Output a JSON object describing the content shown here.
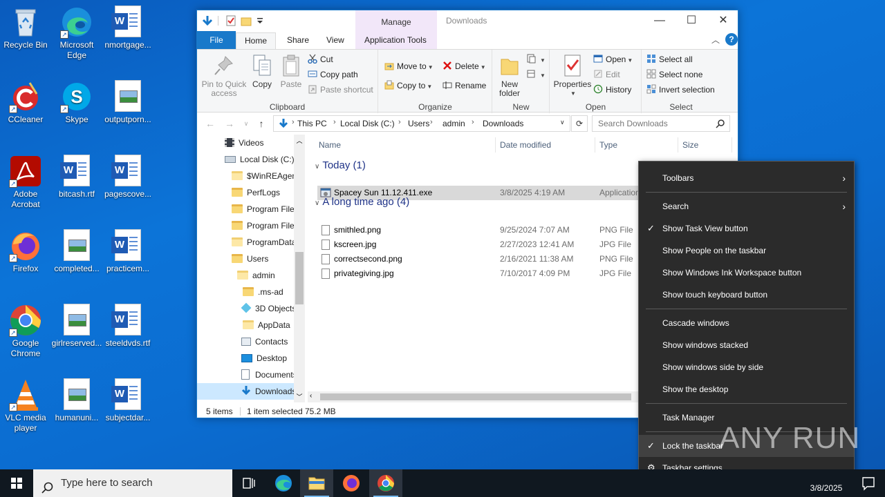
{
  "desktop": {
    "icons": [
      {
        "label": "Recycle Bin",
        "kind": "recycle-bin"
      },
      {
        "label": "Microsoft Edge",
        "kind": "edge"
      },
      {
        "label": "nmortgage...",
        "kind": "word"
      },
      {
        "label": "CCleaner",
        "kind": "ccleaner"
      },
      {
        "label": "Skype",
        "kind": "skype"
      },
      {
        "label": "outputporn...",
        "kind": "image"
      },
      {
        "label": "Adobe Acrobat",
        "kind": "acrobat"
      },
      {
        "label": "bitcash.rtf",
        "kind": "word"
      },
      {
        "label": "pagescove...",
        "kind": "word"
      },
      {
        "label": "Firefox",
        "kind": "firefox"
      },
      {
        "label": "completed...",
        "kind": "image"
      },
      {
        "label": "practicem...",
        "kind": "word"
      },
      {
        "label": "Google Chrome",
        "kind": "chrome"
      },
      {
        "label": "girlreserved...",
        "kind": "image"
      },
      {
        "label": "steeldvds.rtf",
        "kind": "word"
      },
      {
        "label": "VLC media player",
        "kind": "vlc"
      },
      {
        "label": "humanuni...",
        "kind": "image"
      },
      {
        "label": "subjectdar...",
        "kind": "word"
      }
    ]
  },
  "explorer": {
    "title": "Downloads",
    "manage_label": "Manage",
    "tabs": {
      "file": "File",
      "home": "Home",
      "share": "Share",
      "view": "View",
      "app_tools": "Application Tools"
    },
    "ribbon": {
      "clipboard": {
        "label": "Clipboard",
        "pin": "Pin to Quick access",
        "copy": "Copy",
        "paste": "Paste",
        "cut": "Cut",
        "copy_path": "Copy path",
        "paste_shortcut": "Paste shortcut"
      },
      "organize": {
        "label": "Organize",
        "move_to": "Move to",
        "copy_to": "Copy to",
        "delete": "Delete",
        "rename": "Rename"
      },
      "new": {
        "label": "New",
        "new_folder": "New folder"
      },
      "open": {
        "label": "Open",
        "properties": "Properties",
        "open": "Open",
        "edit": "Edit",
        "history": "History"
      },
      "select": {
        "label": "Select",
        "select_all": "Select all",
        "select_none": "Select none",
        "invert": "Invert selection"
      }
    },
    "address": {
      "crumbs": [
        "This PC",
        "Local Disk (C:)",
        "Users",
        "admin",
        "Downloads"
      ],
      "search_placeholder": "Search Downloads"
    },
    "nav_pane": [
      {
        "label": "Videos",
        "kind": "videos"
      },
      {
        "label": "Local Disk (C:)",
        "kind": "drive"
      },
      {
        "label": "$WinREAgent",
        "kind": "folder-pale"
      },
      {
        "label": "PerfLogs",
        "kind": "folder"
      },
      {
        "label": "Program Files",
        "kind": "folder"
      },
      {
        "label": "Program Files",
        "kind": "folder"
      },
      {
        "label": "ProgramData",
        "kind": "folder-pale"
      },
      {
        "label": "Users",
        "kind": "folder"
      },
      {
        "label": "admin",
        "kind": "folder-pale"
      },
      {
        "label": ".ms-ad",
        "kind": "folder"
      },
      {
        "label": "3D Objects",
        "kind": "3d"
      },
      {
        "label": "AppData",
        "kind": "folder-pale"
      },
      {
        "label": "Contacts",
        "kind": "contacts"
      },
      {
        "label": "Desktop",
        "kind": "desktop"
      },
      {
        "label": "Documents",
        "kind": "documents"
      },
      {
        "label": "Downloads",
        "kind": "downloads"
      }
    ],
    "columns": {
      "name": "Name",
      "date": "Date modified",
      "type": "Type",
      "size": "Size"
    },
    "groups": [
      {
        "title": "Today (1)",
        "files": [
          {
            "name": "Spacey Sun 11.12.411.exe",
            "date": "3/8/2025 4:19 AM",
            "type": "Application",
            "selected": true
          }
        ]
      },
      {
        "title": "A long time ago (4)",
        "files": [
          {
            "name": "smithled.png",
            "date": "9/25/2024 7:07 AM",
            "type": "PNG File"
          },
          {
            "name": "kscreen.jpg",
            "date": "2/27/2023 12:41 AM",
            "type": "JPG File"
          },
          {
            "name": "correctsecond.png",
            "date": "2/16/2021 11:38 AM",
            "type": "PNG File"
          },
          {
            "name": "privategiving.jpg",
            "date": "7/10/2017 4:09 PM",
            "type": "JPG File"
          }
        ]
      }
    ],
    "status": {
      "items": "5 items",
      "selected": "1 item selected",
      "size": "75.2 MB"
    }
  },
  "context_menu": {
    "items": [
      {
        "label": "Toolbars",
        "submenu": true
      },
      {
        "label": "Search",
        "submenu": true
      },
      {
        "label": "Show Task View button",
        "checked": true
      },
      {
        "label": "Show People on the taskbar"
      },
      {
        "label": "Show Windows Ink Workspace button"
      },
      {
        "label": "Show touch keyboard button"
      },
      {
        "label": "Cascade windows"
      },
      {
        "label": "Show windows stacked"
      },
      {
        "label": "Show windows side by side"
      },
      {
        "label": "Show the desktop"
      },
      {
        "label": "Task Manager"
      },
      {
        "label": "Lock the taskbar",
        "checked": true,
        "highlighted": true
      },
      {
        "label": "Taskbar settings",
        "icon": "gear-icon"
      }
    ]
  },
  "taskbar": {
    "search_placeholder": "Type here to search",
    "date": "3/8/2025"
  },
  "watermark": "ANY RUN",
  "colors": {
    "accent": "#1979ca",
    "menu_bg": "#2b2b2b",
    "taskbar_bg": "#101820",
    "manage_tab": "#f2e7f9"
  }
}
